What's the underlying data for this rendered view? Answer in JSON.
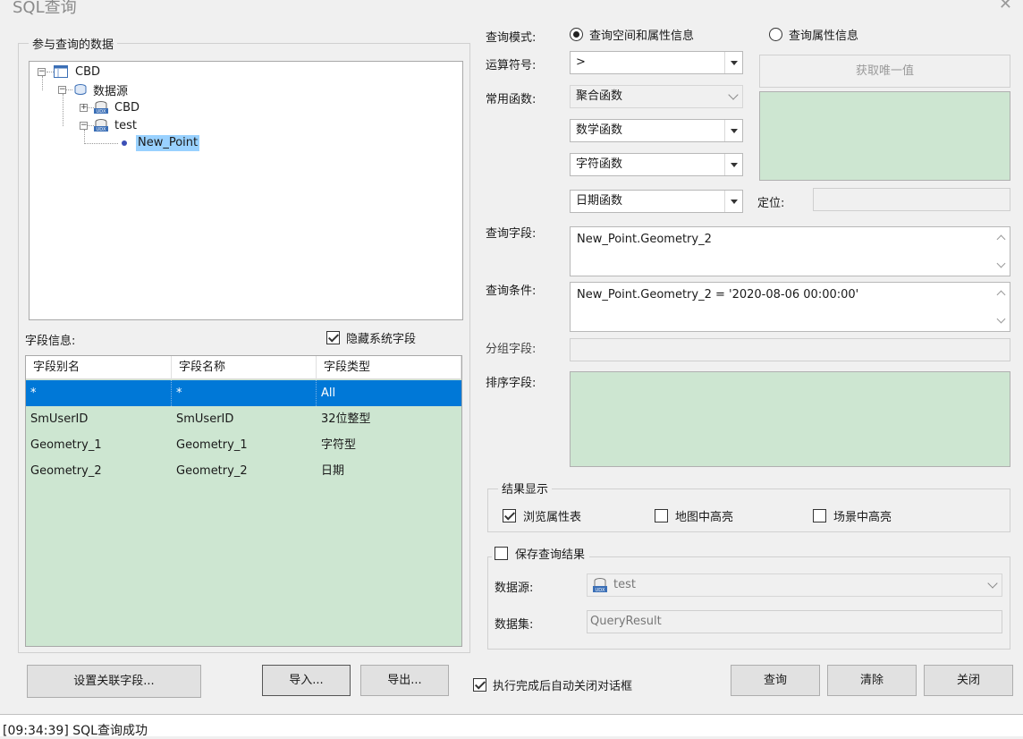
{
  "window": {
    "title": "SQL查询"
  },
  "data_panel": {
    "legend": "参与查询的数据",
    "tree": {
      "root": "CBD",
      "datasources_node": "数据源",
      "ds1": "CBD",
      "ds2": "test",
      "dataset": "New_Point"
    }
  },
  "fields": {
    "label": "字段信息:",
    "hide_system_label": "隐藏系统字段",
    "hide_system_checked": true,
    "columns": [
      "字段别名",
      "字段名称",
      "字段类型"
    ],
    "rows": [
      [
        "*",
        "*",
        "All"
      ],
      [
        "SmUserID",
        "SmUserID",
        "32位整型"
      ],
      [
        "Geometry_1",
        "Geometry_1",
        "字符型"
      ],
      [
        "Geometry_2",
        "Geometry_2",
        "日期"
      ]
    ]
  },
  "query": {
    "mode_label": "查询模式:",
    "mode_option1": "查询空间和属性信息",
    "mode_option2": "查询属性信息",
    "mode_selected": 1,
    "operator_label": "运算符号:",
    "operator_value": ">",
    "get_unique_button": "获取唯一值",
    "functions_label": "常用函数:",
    "func_aggregate": "聚合函数",
    "func_math": "数学函数",
    "func_string": "字符函数",
    "func_date": "日期函数",
    "locate_label": "定位:",
    "query_field_label": "查询字段:",
    "query_field_value": "New_Point.Geometry_2",
    "condition_label": "查询条件:",
    "condition_value": "New_Point.Geometry_2 = '2020-08-06 00:00:00'",
    "group_label": "分组字段:",
    "sort_label": "排序字段:"
  },
  "result_display": {
    "legend": "结果显示",
    "browse_table": "浏览属性表",
    "browse_table_checked": true,
    "map_highlight": "地图中高亮",
    "scene_highlight": "场景中高亮"
  },
  "save_result": {
    "label": "保存查询结果",
    "checked": false,
    "datasource_label": "数据源:",
    "datasource_value": "test",
    "dataset_label": "数据集:",
    "dataset_value": "QueryResult"
  },
  "bottom": {
    "set_relation_button": "设置关联字段...",
    "import_button": "导入...",
    "export_button": "导出...",
    "auto_close_label": "执行完成后自动关闭对话框",
    "auto_close_checked": true,
    "query_button": "查询",
    "clear_button": "清除",
    "close_button": "关闭"
  },
  "log": {
    "line": "[09:34:39] SQL查询成功"
  },
  "colors": {
    "selection": "#0078d7",
    "green_area": "#cde6d1",
    "tree_selection": "#99d1ff"
  }
}
